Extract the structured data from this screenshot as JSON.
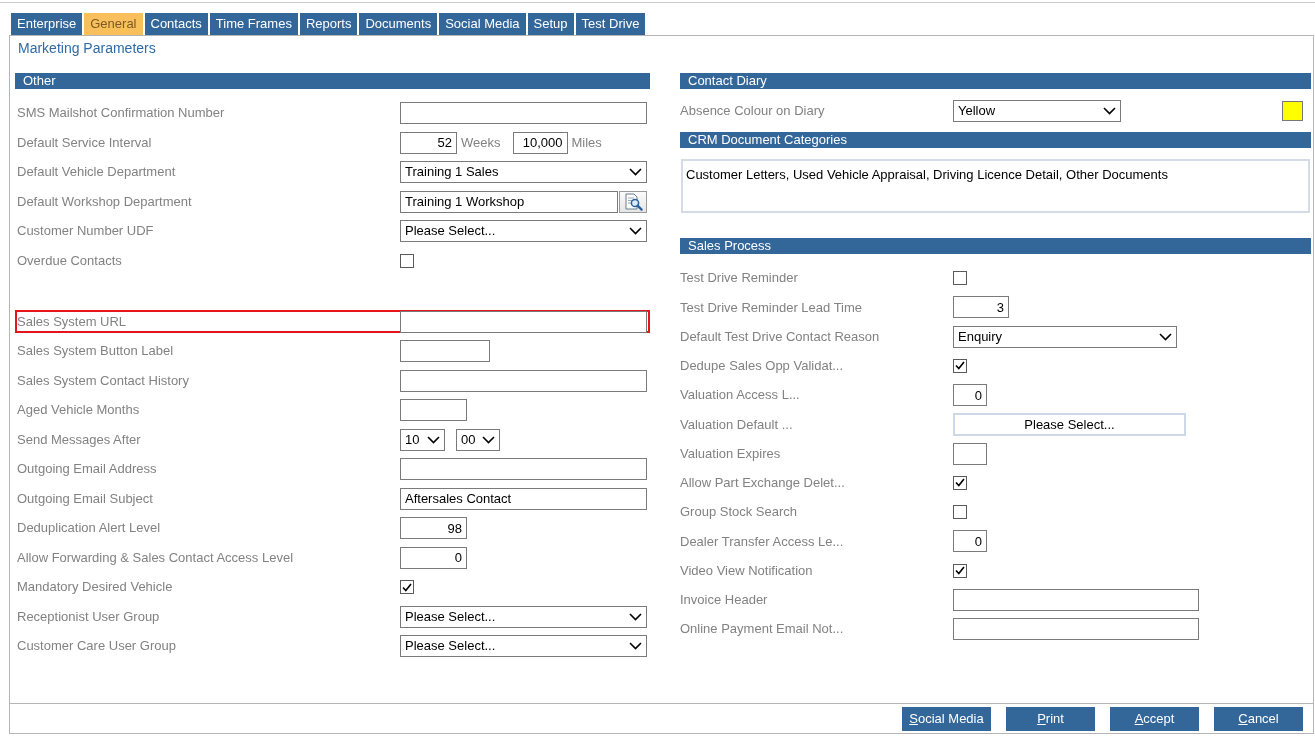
{
  "tabs": [
    {
      "label": "Enterprise",
      "selected": false
    },
    {
      "label": "General",
      "selected": true
    },
    {
      "label": "Contacts",
      "selected": false
    },
    {
      "label": "Time Frames",
      "selected": false
    },
    {
      "label": "Reports",
      "selected": false
    },
    {
      "label": "Documents",
      "selected": false
    },
    {
      "label": "Social Media",
      "selected": false
    },
    {
      "label": "Setup",
      "selected": false
    },
    {
      "label": "Test Drive",
      "selected": false
    }
  ],
  "page_title": "Marketing Parameters",
  "other": {
    "title": "Other",
    "groups": [
      {
        "rows": [
          {
            "label": "SMS Mailshot Confirmation Number",
            "kind": "text",
            "highlighted": false
          },
          {
            "label": "Default Service Interval",
            "kind": "interval",
            "highlighted": false,
            "parts": [
              {
                "value": "52",
                "unit": "Weeks"
              },
              {
                "value": "10,000",
                "unit": "Miles"
              }
            ]
          },
          {
            "label": "Default Vehicle Department",
            "kind": "select",
            "value": "Training 1 Sales",
            "highlighted": false
          },
          {
            "label": "Default Workshop Department",
            "kind": "lookup",
            "value": "Training 1 Workshop",
            "highlighted": false
          },
          {
            "label": "Customer Number UDF",
            "kind": "select",
            "value": "Please Select...",
            "highlighted": false
          },
          {
            "label": "Overdue Contacts",
            "kind": "checkbox",
            "checked": false,
            "highlighted": false
          }
        ]
      },
      {
        "rows": [
          {
            "label": "Sales System URL",
            "kind": "text",
            "highlighted": true
          },
          {
            "label": "Sales System Button Label",
            "kind": "text",
            "highlighted": false
          },
          {
            "label": "Sales System Contact History",
            "kind": "text",
            "highlighted": false
          },
          {
            "label": "Aged Vehicle Months",
            "kind": "text",
            "highlighted": false
          },
          {
            "label": "Send Messages After",
            "kind": "time",
            "highlighted": false,
            "parts": [
              {
                "value": "10"
              },
              {
                "value": "00"
              }
            ]
          },
          {
            "label": "Outgoing Email Address",
            "kind": "text",
            "highlighted": false
          },
          {
            "label": "Outgoing Email Subject",
            "kind": "text",
            "value": "Aftersales Contact",
            "highlighted": false
          },
          {
            "label": "Deduplication Alert Level",
            "kind": "number",
            "value": "98",
            "highlighted": false
          },
          {
            "label": "Allow Forwarding & Sales Contact Access Level",
            "kind": "number",
            "value": "0",
            "highlighted": false
          },
          {
            "label": "Mandatory Desired Vehicle",
            "kind": "checkbox",
            "checked": true,
            "highlighted": false
          },
          {
            "label": "Receptionist User Group",
            "kind": "select",
            "value": "Please Select...",
            "highlighted": false
          },
          {
            "label": "Customer Care User Group",
            "kind": "select",
            "value": "Please Select...",
            "highlighted": false
          }
        ]
      }
    ]
  },
  "contact_diary": {
    "title": "Contact Diary",
    "rows": [
      {
        "label": "Absence Colour on Diary",
        "kind": "colour-select",
        "value": "Yellow",
        "color": "#ffff00"
      }
    ]
  },
  "crm_document_categories": {
    "title": "CRM Document Categories",
    "text": "Customer Letters, Used Vehicle Appraisal, Driving Licence Detail, Other Documents"
  },
  "sales_process": {
    "title": "Sales Process",
    "rows": [
      {
        "label": "Test Drive Reminder",
        "kind": "checkbox",
        "checked": false
      },
      {
        "label": "Test Drive Reminder Lead Time",
        "kind": "number",
        "value": "3"
      },
      {
        "label": "Default Test Drive Contact Reason",
        "kind": "select",
        "value": "Enquiry"
      },
      {
        "label": "Dedupe Sales Opp Validat...",
        "kind": "checkbox",
        "checked": true
      },
      {
        "label": "Valuation Access L...",
        "kind": "number",
        "value": "0"
      },
      {
        "label": "Valuation Default ...",
        "kind": "picker",
        "value": "Please Select..."
      },
      {
        "label": "Valuation Expires",
        "kind": "text"
      },
      {
        "label": "Allow Part Exchange Delet...",
        "kind": "checkbox",
        "checked": true
      },
      {
        "label": "Group Stock Search",
        "kind": "checkbox",
        "checked": false
      },
      {
        "label": "Dealer Transfer Access Le...",
        "kind": "number",
        "value": "0"
      },
      {
        "label": "Video View Notification",
        "kind": "checkbox",
        "checked": true
      },
      {
        "label": "Invoice Header",
        "kind": "text"
      },
      {
        "label": "Online Payment Email Not...",
        "kind": "text"
      }
    ]
  },
  "buttons": [
    {
      "label": "Social Media",
      "access_key_underlined": true
    },
    {
      "label": "Print",
      "access_key_underlined": true
    },
    {
      "label": "Accept",
      "access_key_underlined": true
    },
    {
      "label": "Cancel",
      "access_key_underlined": true
    }
  ]
}
